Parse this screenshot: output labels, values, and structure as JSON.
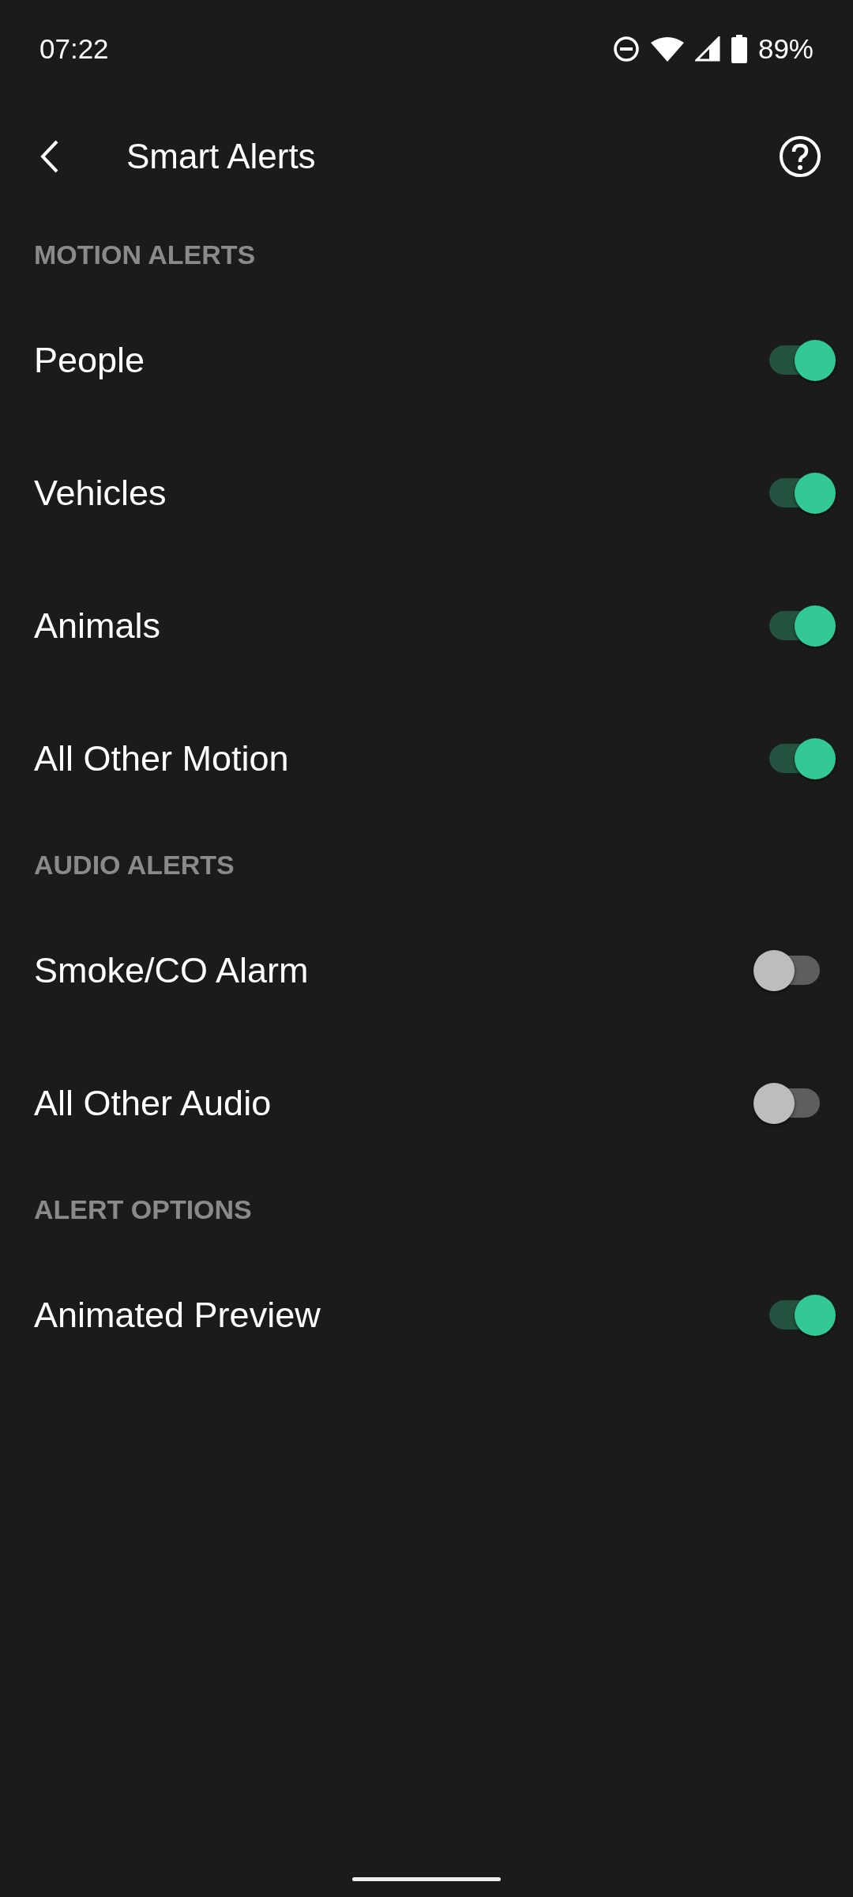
{
  "status_bar": {
    "time": "07:22",
    "battery": "89%"
  },
  "header": {
    "title": "Smart Alerts"
  },
  "sections": [
    {
      "title": "MOTION ALERTS",
      "items": [
        {
          "label": "People",
          "on": true
        },
        {
          "label": "Vehicles",
          "on": true
        },
        {
          "label": "Animals",
          "on": true
        },
        {
          "label": "All Other Motion",
          "on": true
        }
      ]
    },
    {
      "title": "AUDIO ALERTS",
      "items": [
        {
          "label": "Smoke/CO Alarm",
          "on": false
        },
        {
          "label": "All Other Audio",
          "on": false
        }
      ]
    },
    {
      "title": "ALERT OPTIONS",
      "items": [
        {
          "label": "Animated Preview",
          "on": true
        }
      ]
    }
  ]
}
